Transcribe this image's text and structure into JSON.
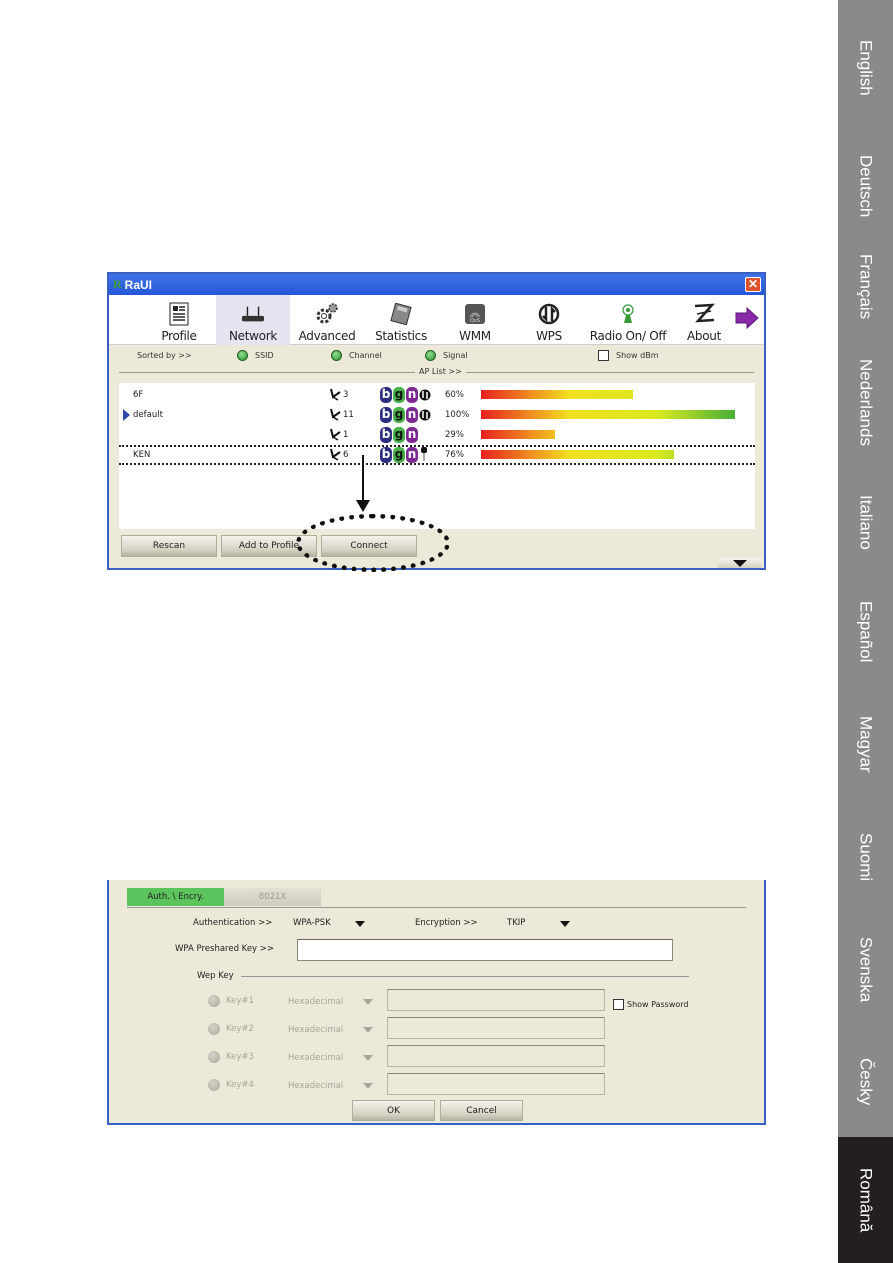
{
  "languages": [
    {
      "label": "English",
      "active": false
    },
    {
      "label": "Deutsch",
      "active": false
    },
    {
      "label": "Français",
      "active": false
    },
    {
      "label": "Nederlands",
      "active": false
    },
    {
      "label": "Italiano",
      "active": false
    },
    {
      "label": "Español",
      "active": false
    },
    {
      "label": "Magyar",
      "active": false
    },
    {
      "label": "Suomi",
      "active": false
    },
    {
      "label": "Svenska",
      "active": false
    },
    {
      "label": "Česky",
      "active": false
    },
    {
      "label": "Română",
      "active": true
    }
  ],
  "window1": {
    "title": "RaUI",
    "logo": "R",
    "close_label": "✕",
    "toolbar": [
      {
        "label": "Profile",
        "icon": "profile-icon"
      },
      {
        "label": "Network",
        "icon": "router-icon",
        "active": true
      },
      {
        "label": "Advanced",
        "icon": "gears-icon"
      },
      {
        "label": "Statistics",
        "icon": "calculator-icon"
      },
      {
        "label": "WMM",
        "icon": "qos-icon"
      },
      {
        "label": "WPS",
        "icon": "wps-icon"
      },
      {
        "label": "Radio On/ Off",
        "icon": "radio-icon"
      },
      {
        "label": "About",
        "icon": "about-icon"
      }
    ],
    "sort": {
      "label": "Sorted by >>",
      "options": [
        "SSID",
        "Channel",
        "Signal"
      ],
      "show_dbm": "Show dBm"
    },
    "ap_list_label": "AP List >>",
    "ap_list": [
      {
        "ssid": "6F",
        "channel": "3",
        "modes": [
          "b",
          "g",
          "n"
        ],
        "wps": true,
        "secure": false,
        "signal_label": "60%",
        "signal": 0.6
      },
      {
        "ssid": "default",
        "channel": "11",
        "modes": [
          "b",
          "g",
          "n"
        ],
        "wps": true,
        "secure": false,
        "signal_label": "100%",
        "signal": 1.0,
        "connected": true
      },
      {
        "ssid": "",
        "channel": "1",
        "modes": [
          "b",
          "g",
          "n"
        ],
        "wps": false,
        "secure": false,
        "signal_label": "29%",
        "signal": 0.29
      },
      {
        "ssid": "KEN",
        "channel": "6",
        "modes": [
          "b",
          "g",
          "n"
        ],
        "wps": false,
        "secure": true,
        "signal_label": "76%",
        "signal": 0.76,
        "selected": true
      }
    ],
    "buttons": {
      "rescan": "Rescan",
      "add_to_profile": "Add to Profile",
      "connect": "Connect"
    }
  },
  "window2": {
    "tabs": [
      {
        "label": "Auth. \\ Encry.",
        "active": true
      },
      {
        "label": "8021X",
        "active": false
      }
    ],
    "authentication_label": "Authentication >>",
    "authentication_value": "WPA-PSK",
    "encryption_label": "Encryption >>",
    "encryption_value": "TKIP",
    "wpa_key_label": "WPA Preshared Key >>",
    "wpa_key_value": "",
    "wep_key_label": "Wep Key",
    "wep_keys": [
      {
        "label": "Key#1",
        "format": "Hexadecimal",
        "value": ""
      },
      {
        "label": "Key#2",
        "format": "Hexadecimal",
        "value": ""
      },
      {
        "label": "Key#3",
        "format": "Hexadecimal",
        "value": ""
      },
      {
        "label": "Key#4",
        "format": "Hexadecimal",
        "value": ""
      }
    ],
    "show_password": "Show Password",
    "ok": "OK",
    "cancel": "Cancel"
  }
}
